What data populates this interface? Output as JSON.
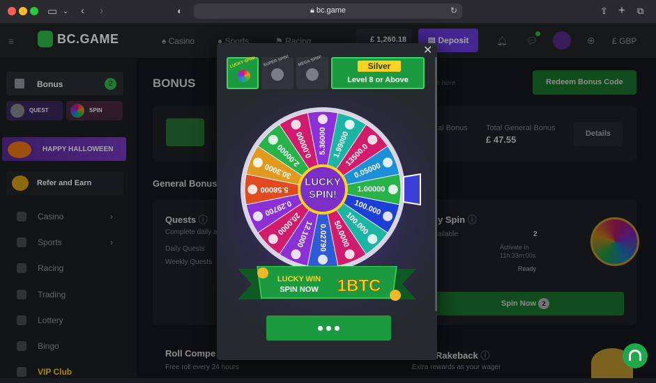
{
  "browser": {
    "url": "bc.game",
    "traffic_lights": [
      "#ff5f57",
      "#febc2e",
      "#28c840"
    ]
  },
  "header": {
    "logo": "BC.GAME",
    "nav": [
      "Casino",
      "Sports",
      "Racing"
    ],
    "balance": "£ 1,260.18",
    "deposit_label": "Deposit",
    "currency": "£ GBP"
  },
  "sidebar": {
    "bonus_label": "Bonus",
    "bonus_count": "2",
    "quest_label": "QUEST",
    "spin_label": "SPIN",
    "halloween_label": "HAPPY HALLOWEEN",
    "refer_label": "Refer and Earn",
    "items": [
      {
        "label": "Casino",
        "arrow": true
      },
      {
        "label": "Sports",
        "arrow": true
      },
      {
        "label": "Racing",
        "arrow": false
      },
      {
        "label": "Trading",
        "arrow": false
      },
      {
        "label": "Lottery",
        "arrow": false
      },
      {
        "label": "Bingo",
        "arrow": false
      },
      {
        "label": "VIP Club",
        "arrow": false
      }
    ]
  },
  "main": {
    "title": "BONUS",
    "redeem_label": "Redeem Bonus Code",
    "general_bonus_label": "al Bonus",
    "total_general_bonus_label": "Total General Bonus",
    "total_general_bonus_value": "£ 47.55",
    "details_label": "Details",
    "general_bonus_section": "General Bonus",
    "quests": {
      "title": "Quests",
      "subtitle": "Complete daily ar",
      "rows": [
        "Daily Quests",
        "Weekly Quests"
      ]
    },
    "lucky_spin": {
      "title": "y Spin",
      "available_label": "ailable",
      "available_value": "2",
      "activate_label": "Activate in",
      "activate_time": "11h:33m:00s",
      "ready_label": "Ready",
      "spin_now_label": "Spin Now",
      "spin_now_count": "2"
    },
    "roll": {
      "title": "Roll Compe",
      "subtitle": "Free roll every 24 hours"
    },
    "rakeback": {
      "title": "Rakeback",
      "subtitle": "Extra rewards as your wager"
    },
    "search_fragment": "e here"
  },
  "modal": {
    "tabs": [
      "LUCKY SPIN!",
      "SUPER SPIN!",
      "MEGA SPIN!"
    ],
    "level_name": "Silver",
    "level_req": "Level 8 or Above",
    "wheel_center": [
      "LUCKY",
      "SPIN!"
    ],
    "wheel_values": [
      "5.36000",
      "1.99000",
      "13500.0",
      "0.05000",
      "1.00000",
      "100.000",
      "100.000",
      "50.0000",
      "0.02790",
      "12.1000",
      "20.0000",
      "0.29700",
      "5.58000",
      "30.3000",
      "2.00000",
      "0.00000"
    ],
    "wheel_colors": [
      "#8b2fd6",
      "#1db4a3",
      "#d11c6d",
      "#1c8fd6",
      "#27b24a",
      "#1c3fd6",
      "#1db4a3",
      "#d11c6d",
      "#2f5bd6",
      "#8b2fd6",
      "#d11c6d",
      "#8b2fd6",
      "#e04a1f",
      "#e09a1f",
      "#27b24a",
      "#d11c6d"
    ],
    "banner_top": "LUCKY WIN",
    "banner_bottom": "SPIN NOW",
    "banner_prize": "1BTC",
    "close_icon": "close-icon"
  }
}
